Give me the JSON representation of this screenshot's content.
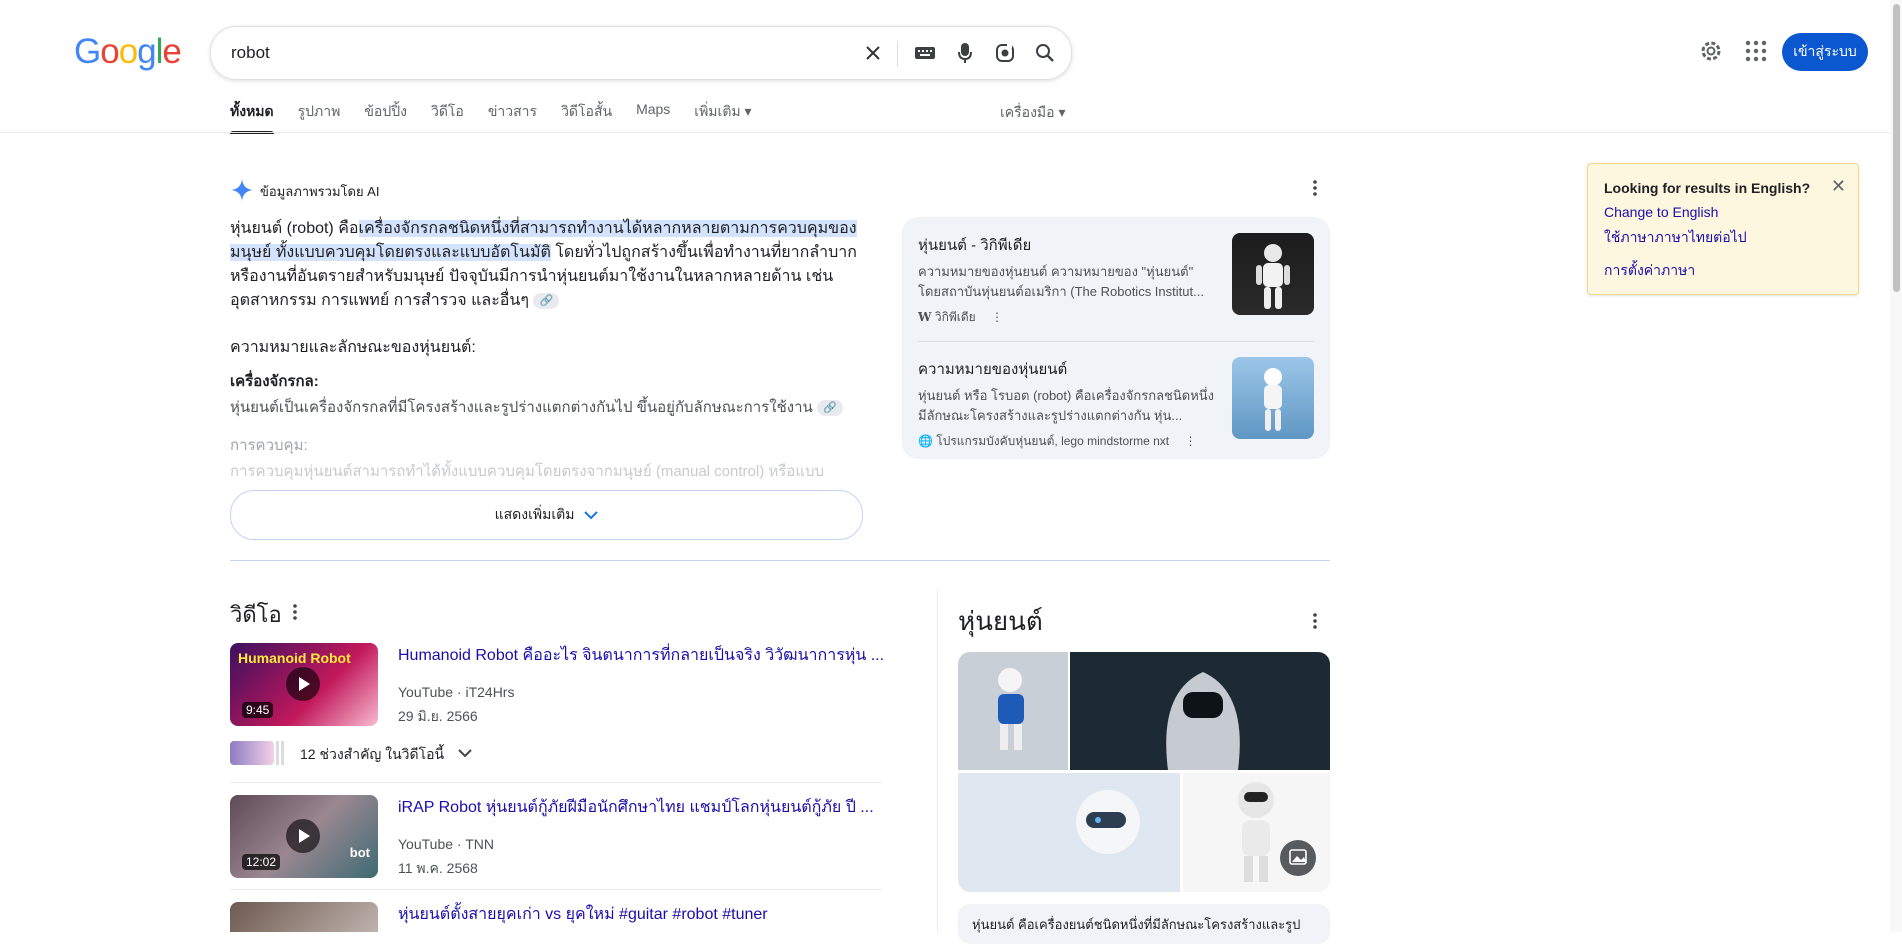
{
  "logo": "Google",
  "search": {
    "query": "robot"
  },
  "header": {
    "signin_label": "เข้าสู่ระบบ"
  },
  "tabs": [
    {
      "label": "ทั้งหมด",
      "active": true
    },
    {
      "label": "รูปภาพ"
    },
    {
      "label": "ข้อปปิ้ง"
    },
    {
      "label": "วิดีโอ"
    },
    {
      "label": "ข่าวสาร"
    },
    {
      "label": "วิดีโอสั้น"
    },
    {
      "label": "Maps"
    },
    {
      "label": "เพิ่มเติม ▾"
    }
  ],
  "tools_label": "เครื่องมือ ▾",
  "ai_overview": {
    "title": "ข้อมูลภาพรวมโดย AI",
    "para_1": "หุ่นยนต์ (robot) คือ",
    "para_hl": "เครื่องจักรกลชนิดหนึ่งที่สามารถทำงานได้หลากหลายตามการควบคุมของมนุษย์ ทั้งแบบควบคุมโดยตรงและแบบอัตโนมัติ",
    "para_2": " โดยทั่วไปถูกสร้างขึ้นเพื่อทำงานที่ยากลำบาก หรืองานที่อันตรายสำหรับมนุษย์ ปัจจุบันมีการนำหุ่นยนต์มาใช้งานในหลากหลายด้าน เช่น อุตสาหกรรม การแพทย์ การสำรวจ และอื่นๆ",
    "heading": "ความหมายและลักษณะของหุ่นยนต์:",
    "sub1": "เครื่องจักรกล:",
    "sub1_text": "หุ่นยนต์เป็นเครื่องจักรกลที่มีโครงสร้างและรูปร่างแตกต่างกันไป ขึ้นอยู่กับลักษณะการใช้งาน",
    "sub2": "การควบคุม:",
    "sub2_text": "การควบคุมหุ่นยนต์สามารถทำได้ทั้งแบบควบคุมโดยตรงจากมนุษย์ (manual control) หรือแบบ",
    "show_more": "แสดงเพิ่มเติม"
  },
  "sources": [
    {
      "title": "หุ่นยนต์ - วิกิพีเดีย",
      "desc": "ความหมายของหุ่นยนต์ ความหมายของ \"หุ่นยนต์\" โดยสถาบันหุ่นยนต์อเมริกา (The Robotics Institut...",
      "meta": "วิกิพีเดีย"
    },
    {
      "title": "ความหมายของหุ่นยนต์",
      "desc": "หุ่นยนต์ หรือ โรบอต (robot) คือเครื่องจักรกลชนิดหนึ่ง มีลักษณะโครงสร้างและรูปร่างแตกต่างกัน หุ่น...",
      "meta": "โปรแกรมบังคับหุ่นยนต์, lego mindstorme nxt"
    }
  ],
  "language_box": {
    "question": "Looking for results in English?",
    "change": "Change to English",
    "keep": "ใช้ภาษาภาษาไทยต่อไป",
    "settings": "การตั้งค่าภาษา"
  },
  "videos": {
    "heading": "วิดีโอ",
    "items": [
      {
        "title": "Humanoid Robot คืออะไร จินตนาการที่กลายเป็นจริง วิวัฒนาการหุ่น ...",
        "source": "YouTube · iT24Hrs",
        "date": "29 มิ.ย. 2566",
        "duration": "9:45",
        "thumb_text": "Humanoid Robot"
      },
      {
        "title": "iRAP Robot หุ่นยนต์กู้ภัยฝีมือนักศึกษาไทย แชมป์โลกหุ่นยนต์กู้ภัย ปี ...",
        "source": "YouTube · TNN",
        "date": "11 พ.ค. 2568",
        "duration": "12:02",
        "thumb_text": "bot"
      },
      {
        "title": "หุ่นยนต์ตั้งสายยุคเก่า vs ยุคใหม่ #guitar #robot #tuner"
      }
    ],
    "moments": "12 ช่วงสำคัญ ในวิดีโอนี้"
  },
  "knowledge_panel": {
    "title": "หุ่นยนต์",
    "desc": "หุ่นยนต์ คือเครื่องยนต์ชนิดหนึ่งที่มีลักษณะโครงสร้างและรูป"
  },
  "colors": {
    "accent": "#0b57d0",
    "link": "#1a0dab",
    "ai_bg": "#f0f4f9"
  }
}
